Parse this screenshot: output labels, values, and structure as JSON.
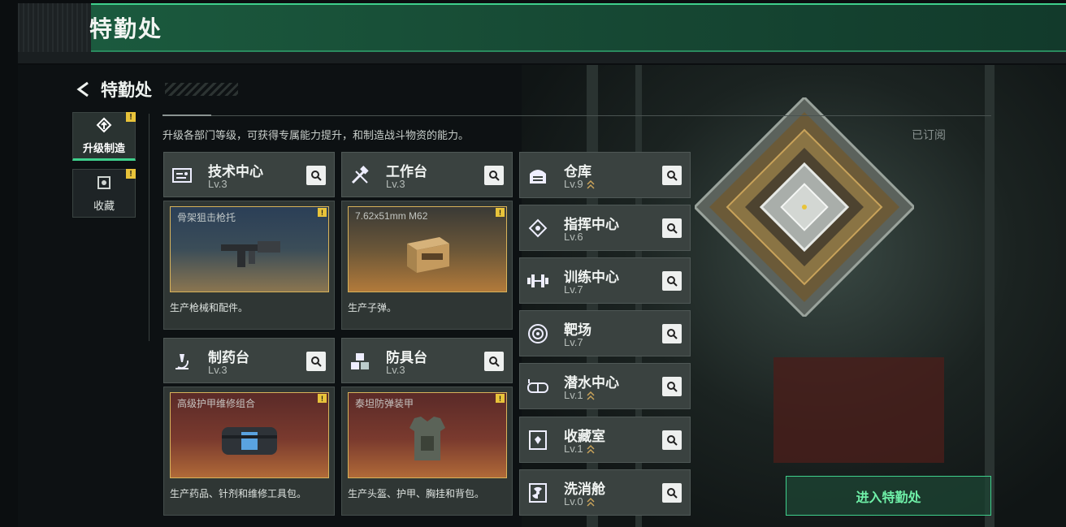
{
  "app": {
    "title": "特勤处"
  },
  "header": {
    "title": "特勤处"
  },
  "side_tabs": [
    {
      "label": "升级制造",
      "active": true,
      "badge": "!"
    },
    {
      "label": "收藏",
      "active": false,
      "badge": "!"
    }
  ],
  "description": "升级各部门等级，可获得专属能力提升，和制造战斗物资的能力。",
  "status": "已订阅",
  "workbenches": [
    {
      "name": "技术中心",
      "level": "Lv.3",
      "icon": "circuit-board-icon",
      "product": "骨架狙击枪托",
      "caption": "生产枪械和配件。",
      "badge": "!"
    },
    {
      "name": "工作台",
      "level": "Lv.3",
      "icon": "hammer-wrench-icon",
      "product": "7.62x51mm M62",
      "caption": "生产子弹。",
      "badge": "!"
    },
    {
      "name": "制药台",
      "level": "Lv.3",
      "icon": "microscope-icon",
      "product": "高级护甲维修组合",
      "caption": "生产药品、针剂和维修工具包。",
      "badge": "!"
    },
    {
      "name": "防具台",
      "level": "Lv.3",
      "icon": "boxes-icon",
      "product": "泰坦防弹装甲",
      "caption": "生产头盔、护甲、胸挂和背包。",
      "badge": "!"
    }
  ],
  "facilities": [
    {
      "name": "仓库",
      "level": "Lv.9",
      "icon": "warehouse-icon",
      "upgradable": true
    },
    {
      "name": "指挥中心",
      "level": "Lv.6",
      "icon": "chip-icon",
      "upgradable": false
    },
    {
      "name": "训练中心",
      "level": "Lv.7",
      "icon": "dumbbell-icon",
      "upgradable": false
    },
    {
      "name": "靶场",
      "level": "Lv.7",
      "icon": "target-icon",
      "upgradable": false
    },
    {
      "name": "潜水中心",
      "level": "Lv.1",
      "icon": "diving-mask-icon",
      "upgradable": true
    },
    {
      "name": "收藏室",
      "level": "Lv.1",
      "icon": "collection-icon",
      "upgradable": true
    },
    {
      "name": "洗消舱",
      "level": "Lv.0",
      "icon": "radiation-icon",
      "upgradable": true
    }
  ],
  "actions": {
    "enter": "进入特勤处"
  },
  "colors": {
    "accent": "#3fd08c",
    "badge": "#e8c33a",
    "panel": "#3a4240"
  }
}
